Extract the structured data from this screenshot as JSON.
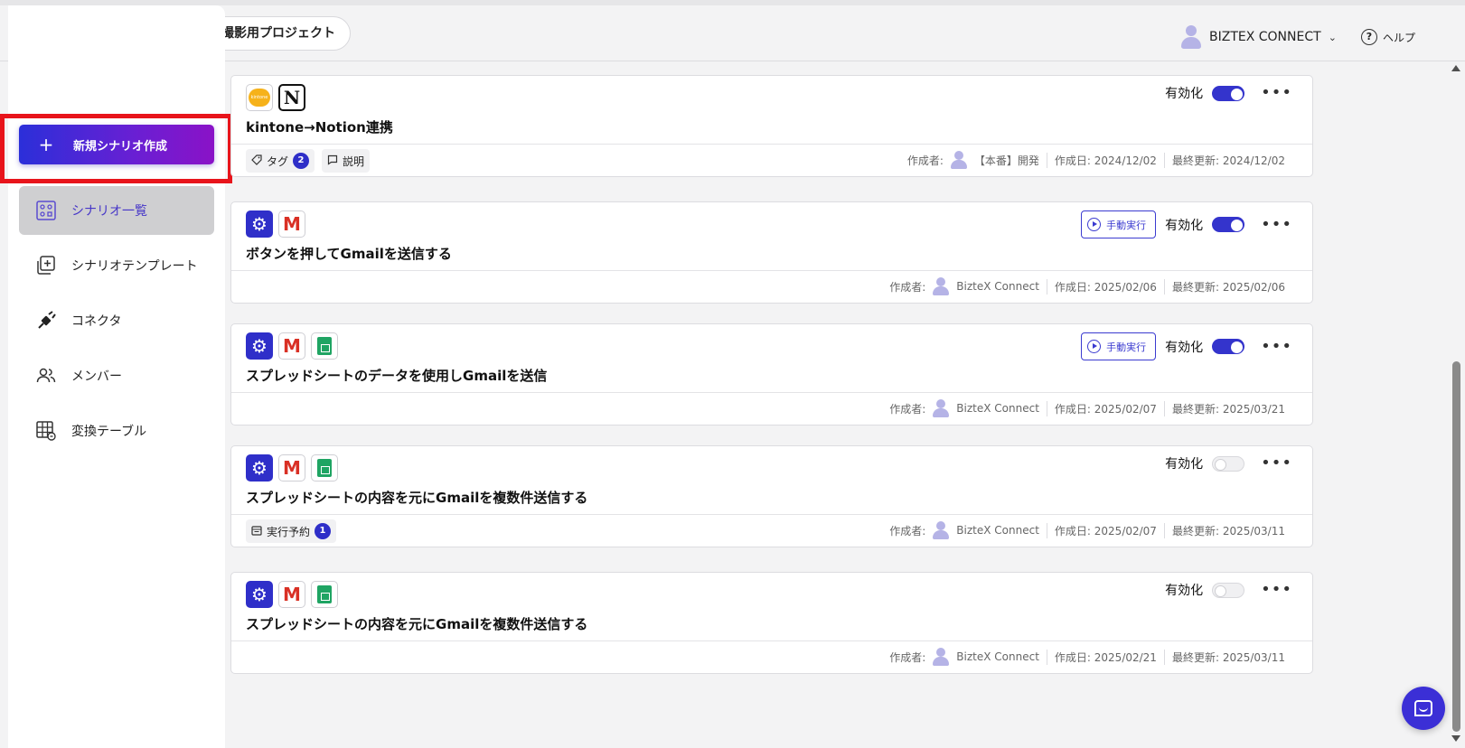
{
  "header": {
    "project_name": "撮影用プロジェクト",
    "account_name": "BIZTEX CONNECT",
    "account_chevron": "⌄",
    "help_label": "ヘルプ",
    "help_icon": "?"
  },
  "sidebar": {
    "create_button": {
      "icon": "+",
      "label": "新規シナリオ作成"
    },
    "items": [
      {
        "label": "シナリオ一覧",
        "icon": "scenario-list-icon",
        "active": true
      },
      {
        "label": "シナリオテンプレート",
        "icon": "template-icon",
        "active": false
      },
      {
        "label": "コネクタ",
        "icon": "connector-plug-icon",
        "active": false
      },
      {
        "label": "メンバー",
        "icon": "members-icon",
        "active": false
      },
      {
        "label": "変換テーブル",
        "icon": "table-icon",
        "active": false
      }
    ]
  },
  "labels": {
    "enable": "有効化",
    "manual_run": "手動実行",
    "author_prefix": "作成者:",
    "created_prefix": "作成日:",
    "updated_prefix": "最終更新:",
    "more": "•••"
  },
  "scenarios": [
    {
      "title": "kintone→Notion連携",
      "apps": [
        "kintone",
        "notion"
      ],
      "kintone_text": "kintone",
      "manual": false,
      "enabled": true,
      "chips": [
        {
          "icon": "tag-icon",
          "label": "タグ",
          "badge": "2"
        },
        {
          "icon": "comment-icon",
          "label": "説明",
          "badge": ""
        }
      ],
      "author": "【本番】開発",
      "created": "2024/12/02",
      "updated": "2024/12/02"
    },
    {
      "title": "ボタンを押してGmailを送信する",
      "apps": [
        "gear",
        "gmail"
      ],
      "manual": true,
      "enabled": true,
      "chips": [],
      "author": "BizteX Connect",
      "created": "2025/02/06",
      "updated": "2025/02/06"
    },
    {
      "title": "スプレッドシートのデータを使用しGmailを送信",
      "apps": [
        "gear",
        "gmail",
        "sheets"
      ],
      "manual": true,
      "enabled": true,
      "chips": [],
      "author": "BizteX Connect",
      "created": "2025/02/07",
      "updated": "2025/03/21"
    },
    {
      "title": "スプレッドシートの内容を元にGmailを複数件送信する",
      "apps": [
        "gear",
        "gmail",
        "sheets"
      ],
      "manual": false,
      "enabled": false,
      "chips": [
        {
          "icon": "calendar-icon",
          "label": "実行予約",
          "badge": "1"
        }
      ],
      "author": "BizteX Connect",
      "created": "2025/02/07",
      "updated": "2025/03/11"
    },
    {
      "title": "スプレッドシートの内容を元にGmailを複数件送信する",
      "apps": [
        "gear",
        "gmail",
        "sheets"
      ],
      "manual": false,
      "enabled": false,
      "chips": [],
      "author": "BizteX Connect",
      "created": "2025/02/21",
      "updated": "2025/03/11"
    }
  ],
  "colors": {
    "accent": "#3434cc",
    "create_gradient_start": "#2b2fd9",
    "create_gradient_end": "#8a12c7",
    "highlight": "#e8141b"
  }
}
